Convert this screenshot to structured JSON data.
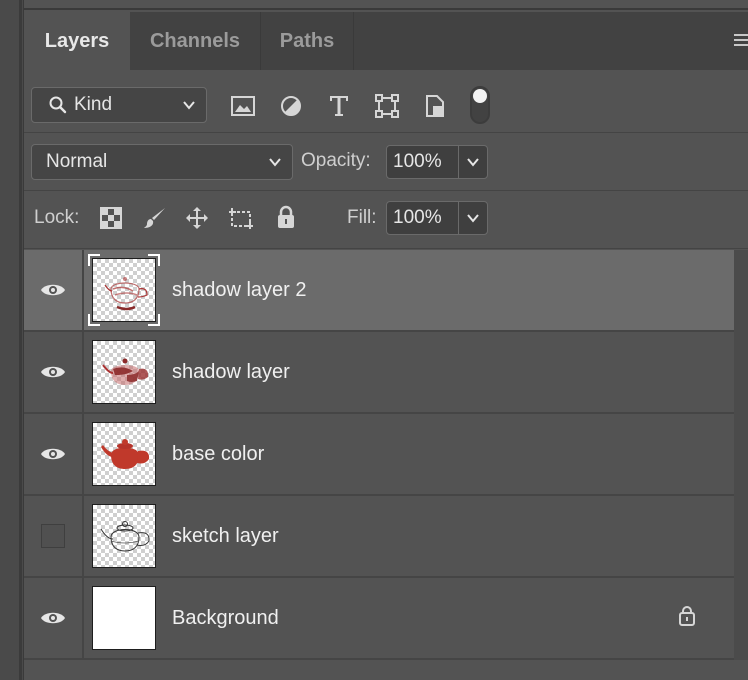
{
  "tabs": [
    {
      "label": "Layers",
      "active": true
    },
    {
      "label": "Channels",
      "active": false
    },
    {
      "label": "Paths",
      "active": false
    }
  ],
  "filter": {
    "kind_label": "Kind",
    "icons": [
      "image-filter-icon",
      "adjustment-filter-icon",
      "type-filter-icon",
      "shape-filter-icon",
      "smart-object-filter-icon",
      "filter-toggle-switch"
    ]
  },
  "blend": {
    "mode": "Normal",
    "opacity_label": "Opacity:",
    "opacity_value": "100%"
  },
  "lock": {
    "label": "Lock:",
    "icons": [
      "lock-transparent-pixels-icon",
      "lock-image-pixels-icon",
      "lock-position-icon",
      "lock-artboard-icon",
      "lock-all-icon"
    ],
    "fill_label": "Fill:",
    "fill_value": "100%"
  },
  "layers": [
    {
      "name": "shadow layer 2",
      "visible": true,
      "selected": true,
      "thumb": "teapot-shadow-faint"
    },
    {
      "name": "shadow layer",
      "visible": true,
      "selected": false,
      "thumb": "teapot-shadow"
    },
    {
      "name": "base color",
      "visible": true,
      "selected": false,
      "thumb": "teapot-red"
    },
    {
      "name": "sketch layer",
      "visible": false,
      "selected": false,
      "thumb": "teapot-sketch"
    },
    {
      "name": "Background",
      "visible": true,
      "selected": false,
      "thumb": "white",
      "locked": true
    }
  ],
  "colors": {
    "panel": "#535353",
    "tabbar": "#424242",
    "selected_row": "#6b6b6b",
    "teapot_red": "#c0392b"
  }
}
